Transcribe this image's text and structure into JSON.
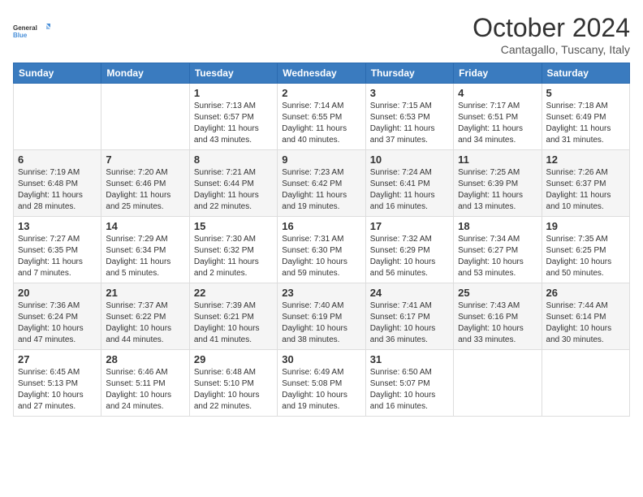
{
  "logo": {
    "text_general": "General",
    "text_blue": "Blue"
  },
  "header": {
    "month": "October 2024",
    "location": "Cantagallo, Tuscany, Italy"
  },
  "weekdays": [
    "Sunday",
    "Monday",
    "Tuesday",
    "Wednesday",
    "Thursday",
    "Friday",
    "Saturday"
  ],
  "weeks": [
    [
      null,
      null,
      {
        "day": 1,
        "sunrise": "Sunrise: 7:13 AM",
        "sunset": "Sunset: 6:57 PM",
        "daylight": "Daylight: 11 hours and 43 minutes."
      },
      {
        "day": 2,
        "sunrise": "Sunrise: 7:14 AM",
        "sunset": "Sunset: 6:55 PM",
        "daylight": "Daylight: 11 hours and 40 minutes."
      },
      {
        "day": 3,
        "sunrise": "Sunrise: 7:15 AM",
        "sunset": "Sunset: 6:53 PM",
        "daylight": "Daylight: 11 hours and 37 minutes."
      },
      {
        "day": 4,
        "sunrise": "Sunrise: 7:17 AM",
        "sunset": "Sunset: 6:51 PM",
        "daylight": "Daylight: 11 hours and 34 minutes."
      },
      {
        "day": 5,
        "sunrise": "Sunrise: 7:18 AM",
        "sunset": "Sunset: 6:49 PM",
        "daylight": "Daylight: 11 hours and 31 minutes."
      }
    ],
    [
      {
        "day": 6,
        "sunrise": "Sunrise: 7:19 AM",
        "sunset": "Sunset: 6:48 PM",
        "daylight": "Daylight: 11 hours and 28 minutes."
      },
      {
        "day": 7,
        "sunrise": "Sunrise: 7:20 AM",
        "sunset": "Sunset: 6:46 PM",
        "daylight": "Daylight: 11 hours and 25 minutes."
      },
      {
        "day": 8,
        "sunrise": "Sunrise: 7:21 AM",
        "sunset": "Sunset: 6:44 PM",
        "daylight": "Daylight: 11 hours and 22 minutes."
      },
      {
        "day": 9,
        "sunrise": "Sunrise: 7:23 AM",
        "sunset": "Sunset: 6:42 PM",
        "daylight": "Daylight: 11 hours and 19 minutes."
      },
      {
        "day": 10,
        "sunrise": "Sunrise: 7:24 AM",
        "sunset": "Sunset: 6:41 PM",
        "daylight": "Daylight: 11 hours and 16 minutes."
      },
      {
        "day": 11,
        "sunrise": "Sunrise: 7:25 AM",
        "sunset": "Sunset: 6:39 PM",
        "daylight": "Daylight: 11 hours and 13 minutes."
      },
      {
        "day": 12,
        "sunrise": "Sunrise: 7:26 AM",
        "sunset": "Sunset: 6:37 PM",
        "daylight": "Daylight: 11 hours and 10 minutes."
      }
    ],
    [
      {
        "day": 13,
        "sunrise": "Sunrise: 7:27 AM",
        "sunset": "Sunset: 6:35 PM",
        "daylight": "Daylight: 11 hours and 7 minutes."
      },
      {
        "day": 14,
        "sunrise": "Sunrise: 7:29 AM",
        "sunset": "Sunset: 6:34 PM",
        "daylight": "Daylight: 11 hours and 5 minutes."
      },
      {
        "day": 15,
        "sunrise": "Sunrise: 7:30 AM",
        "sunset": "Sunset: 6:32 PM",
        "daylight": "Daylight: 11 hours and 2 minutes."
      },
      {
        "day": 16,
        "sunrise": "Sunrise: 7:31 AM",
        "sunset": "Sunset: 6:30 PM",
        "daylight": "Daylight: 10 hours and 59 minutes."
      },
      {
        "day": 17,
        "sunrise": "Sunrise: 7:32 AM",
        "sunset": "Sunset: 6:29 PM",
        "daylight": "Daylight: 10 hours and 56 minutes."
      },
      {
        "day": 18,
        "sunrise": "Sunrise: 7:34 AM",
        "sunset": "Sunset: 6:27 PM",
        "daylight": "Daylight: 10 hours and 53 minutes."
      },
      {
        "day": 19,
        "sunrise": "Sunrise: 7:35 AM",
        "sunset": "Sunset: 6:25 PM",
        "daylight": "Daylight: 10 hours and 50 minutes."
      }
    ],
    [
      {
        "day": 20,
        "sunrise": "Sunrise: 7:36 AM",
        "sunset": "Sunset: 6:24 PM",
        "daylight": "Daylight: 10 hours and 47 minutes."
      },
      {
        "day": 21,
        "sunrise": "Sunrise: 7:37 AM",
        "sunset": "Sunset: 6:22 PM",
        "daylight": "Daylight: 10 hours and 44 minutes."
      },
      {
        "day": 22,
        "sunrise": "Sunrise: 7:39 AM",
        "sunset": "Sunset: 6:21 PM",
        "daylight": "Daylight: 10 hours and 41 minutes."
      },
      {
        "day": 23,
        "sunrise": "Sunrise: 7:40 AM",
        "sunset": "Sunset: 6:19 PM",
        "daylight": "Daylight: 10 hours and 38 minutes."
      },
      {
        "day": 24,
        "sunrise": "Sunrise: 7:41 AM",
        "sunset": "Sunset: 6:17 PM",
        "daylight": "Daylight: 10 hours and 36 minutes."
      },
      {
        "day": 25,
        "sunrise": "Sunrise: 7:43 AM",
        "sunset": "Sunset: 6:16 PM",
        "daylight": "Daylight: 10 hours and 33 minutes."
      },
      {
        "day": 26,
        "sunrise": "Sunrise: 7:44 AM",
        "sunset": "Sunset: 6:14 PM",
        "daylight": "Daylight: 10 hours and 30 minutes."
      }
    ],
    [
      {
        "day": 27,
        "sunrise": "Sunrise: 6:45 AM",
        "sunset": "Sunset: 5:13 PM",
        "daylight": "Daylight: 10 hours and 27 minutes."
      },
      {
        "day": 28,
        "sunrise": "Sunrise: 6:46 AM",
        "sunset": "Sunset: 5:11 PM",
        "daylight": "Daylight: 10 hours and 24 minutes."
      },
      {
        "day": 29,
        "sunrise": "Sunrise: 6:48 AM",
        "sunset": "Sunset: 5:10 PM",
        "daylight": "Daylight: 10 hours and 22 minutes."
      },
      {
        "day": 30,
        "sunrise": "Sunrise: 6:49 AM",
        "sunset": "Sunset: 5:08 PM",
        "daylight": "Daylight: 10 hours and 19 minutes."
      },
      {
        "day": 31,
        "sunrise": "Sunrise: 6:50 AM",
        "sunset": "Sunset: 5:07 PM",
        "daylight": "Daylight: 10 hours and 16 minutes."
      },
      null,
      null
    ]
  ]
}
